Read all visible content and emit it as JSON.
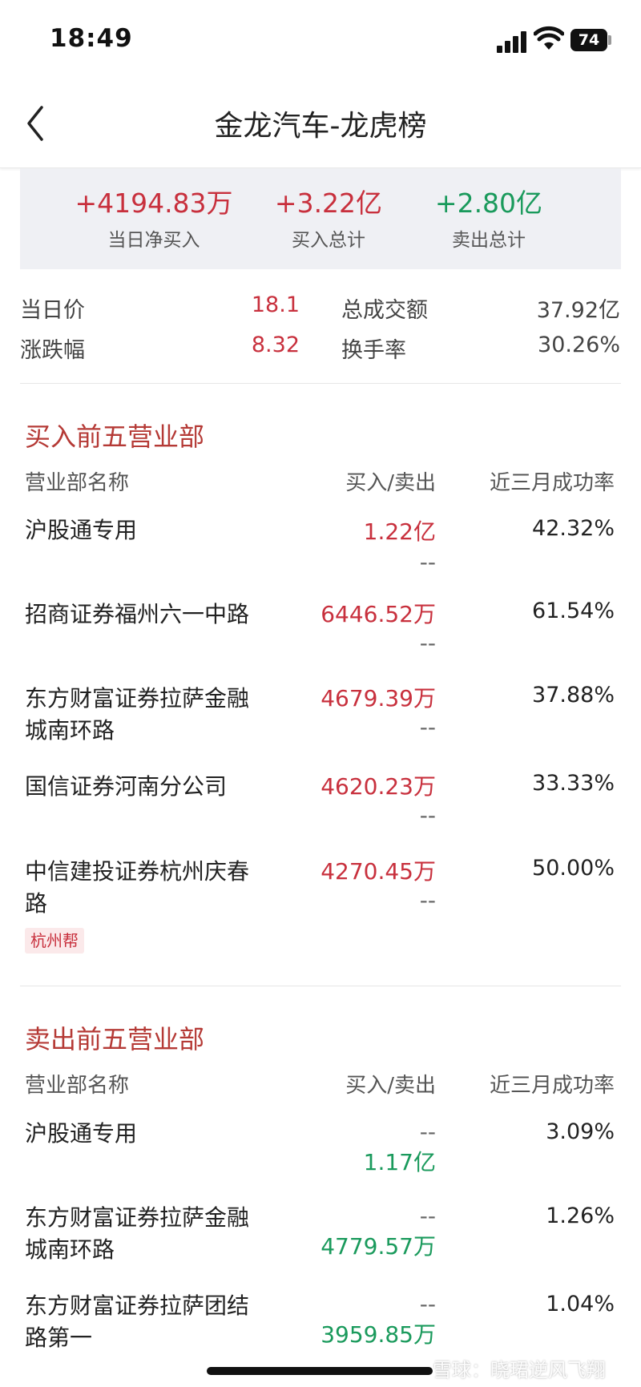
{
  "status": {
    "time": "18:49",
    "battery": "74"
  },
  "nav": {
    "title": "金龙汽车-龙虎榜"
  },
  "summary": {
    "net_buy": {
      "value": "+4194.83万",
      "label": "当日净买入"
    },
    "buy_total": {
      "value": "+3.22亿",
      "label": "买入总计"
    },
    "sell_total": {
      "value": "+2.80亿",
      "label": "卖出总计"
    }
  },
  "stats": {
    "price": {
      "label": "当日价",
      "value": "18.1"
    },
    "turnover_amount": {
      "label": "总成交额",
      "value": "37.92亿"
    },
    "change": {
      "label": "涨跌幅",
      "value": "8.32"
    },
    "turnover_rate": {
      "label": "换手率",
      "value": "30.26%"
    }
  },
  "buy_section": {
    "title": "买入前五营业部",
    "col_name": "营业部名称",
    "col_amount": "买入/卖出",
    "col_rate": "近三月成功率",
    "rows": [
      {
        "name": "沪股通专用",
        "buy": "1.22亿",
        "sell": "--",
        "rate": "42.32%"
      },
      {
        "name": "招商证券福州六一中路",
        "buy": "6446.52万",
        "sell": "--",
        "rate": "61.54%"
      },
      {
        "name": "东方财富证券拉萨金融城南环路",
        "buy": "4679.39万",
        "sell": "--",
        "rate": "37.88%"
      },
      {
        "name": "国信证券河南分公司",
        "buy": "4620.23万",
        "sell": "--",
        "rate": "33.33%"
      },
      {
        "name": "中信建投证券杭州庆春路",
        "buy": "4270.45万",
        "sell": "--",
        "rate": "50.00%",
        "tag": "杭州帮"
      }
    ]
  },
  "sell_section": {
    "title": "卖出前五营业部",
    "col_name": "营业部名称",
    "col_amount": "买入/卖出",
    "col_rate": "近三月成功率",
    "rows": [
      {
        "name": "沪股通专用",
        "buy": "--",
        "sell": "1.17亿",
        "rate": "3.09%"
      },
      {
        "name": "东方财富证券拉萨金融城南环路",
        "buy": "--",
        "sell": "4779.57万",
        "rate": "1.26%"
      },
      {
        "name": "东方财富证券拉萨团结路第一",
        "buy": "--",
        "sell": "3959.85万",
        "rate": "1.04%"
      }
    ]
  },
  "watermark": "雪球：晓珺逆风飞翔"
}
